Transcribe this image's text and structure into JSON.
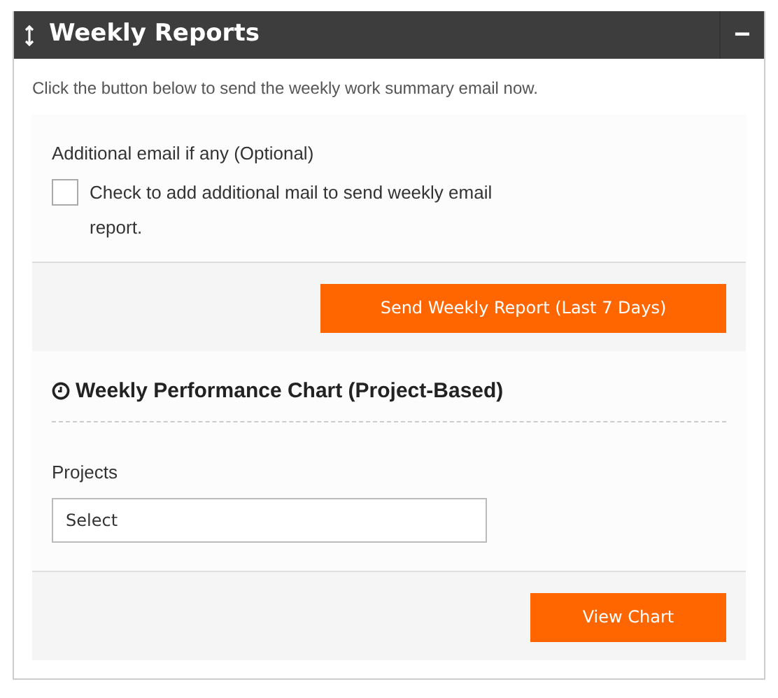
{
  "panel": {
    "title": "Weekly Reports",
    "collapse_symbol": "−"
  },
  "intro": "Click the button below to send the weekly work summary email now.",
  "email_section": {
    "label": "Additional email if any (Optional)",
    "checkbox": {
      "label": "Check to add additional mail to send weekly email report.",
      "checked": false
    },
    "button": "Send Weekly Report (Last 7 Days)"
  },
  "chart_section": {
    "heading": "Weekly Performance Chart (Project-Based)",
    "field_label": "Projects",
    "select": {
      "value": "Select"
    },
    "button": "View Chart"
  }
}
